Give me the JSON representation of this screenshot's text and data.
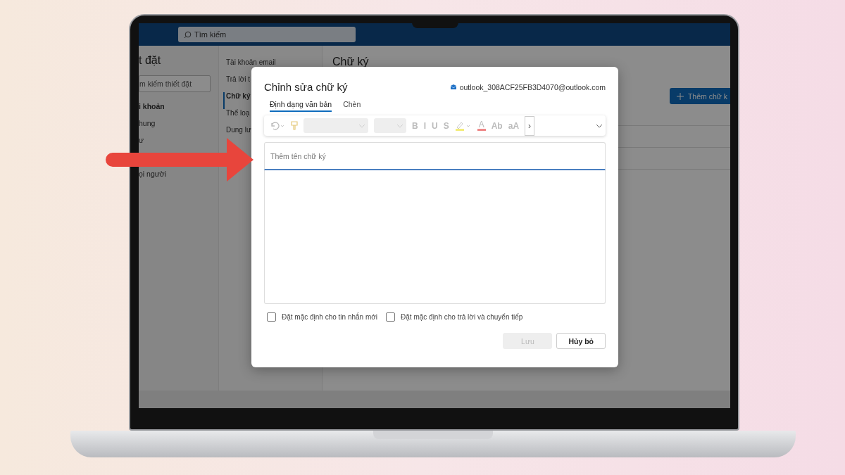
{
  "search": {
    "placeholder": "Tìm kiếm"
  },
  "settings": {
    "title": "t đặt",
    "search": {
      "placeholder": "m kiếm thiết đặt"
    },
    "nav": [
      {
        "label": "i khoản",
        "kind": "heading"
      },
      {
        "label": "hung",
        "kind": "item"
      },
      {
        "label": "ư",
        "kind": "item"
      },
      {
        "label": "ọi người",
        "kind": "item"
      }
    ]
  },
  "subnav": [
    {
      "label": "Tài khoản email",
      "selected": false
    },
    {
      "label": "Trả lời t",
      "selected": false
    },
    {
      "label": "Chữ ký",
      "selected": true
    },
    {
      "label": "Thể loạ",
      "selected": false
    },
    {
      "label": "Dung lư",
      "selected": false
    }
  ],
  "content": {
    "title": "Chữ ký",
    "add_button": "Thêm chữ k"
  },
  "dialog": {
    "title": "Chỉnh sửa chữ ký",
    "account": "outlook_308ACF25FB3D4070@outlook.com",
    "tabs": [
      {
        "label": "Định dạng văn bản",
        "selected": true
      },
      {
        "label": "Chèn",
        "selected": false
      }
    ],
    "toolbar": [
      {
        "kind": "undo"
      },
      {
        "kind": "painter"
      },
      {
        "kind": "font"
      },
      {
        "kind": "size"
      },
      {
        "kind": "letter",
        "label": "B"
      },
      {
        "kind": "letter",
        "label": "I"
      },
      {
        "kind": "letter",
        "label": "U"
      },
      {
        "kind": "letter",
        "label": "S"
      },
      {
        "kind": "highlight"
      },
      {
        "kind": "color",
        "label": "A"
      },
      {
        "kind": "letter",
        "label": "Ab"
      },
      {
        "kind": "letter",
        "label": "aA"
      },
      {
        "kind": "more",
        "label": "›"
      },
      {
        "kind": "expand"
      }
    ],
    "name_field": {
      "placeholder": "Thêm tên chữ ký"
    },
    "checkboxes": [
      {
        "label": "Đặt mặc định cho tin nhắn mới",
        "checked": false
      },
      {
        "label": "Đặt mặc định cho trả lời và chuyển tiếp",
        "checked": false
      }
    ],
    "buttons": [
      {
        "label": "Lưu",
        "disabled": true
      },
      {
        "label": "Hủy bỏ",
        "disabled": false
      }
    ]
  }
}
